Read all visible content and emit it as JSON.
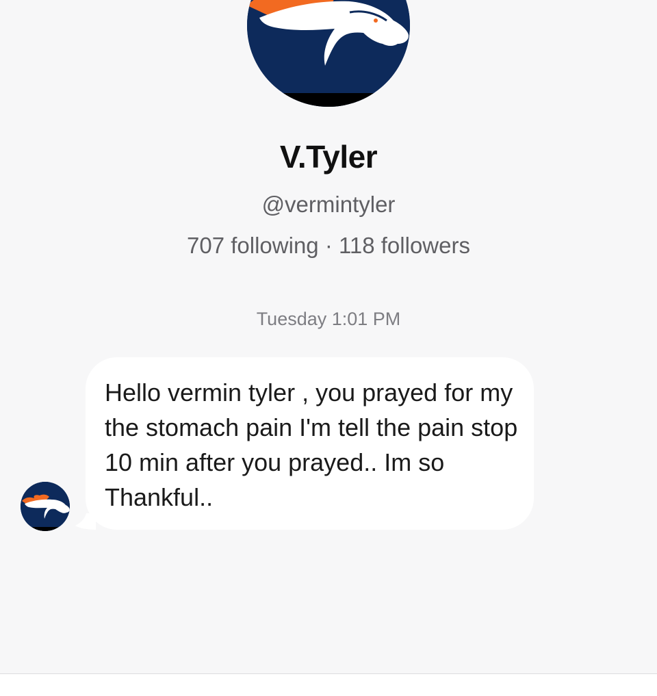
{
  "profile": {
    "avatar_icon": "broncos-horse-logo-icon",
    "display_name": "V.Tyler",
    "handle": "@vermintyler",
    "follow_stats": "707 following · 118 followers"
  },
  "conversation": {
    "timestamp": "Tuesday 1:01 PM",
    "messages": [
      {
        "sender_avatar_icon": "broncos-horse-logo-icon",
        "text": "Hello vermin tyler , you prayed for my the stomach pain I'm tell the pain stop 10 min after you prayed.. Im so Thankful.."
      }
    ]
  },
  "colors": {
    "background": "#f7f7f8",
    "bubble": "#ffffff",
    "logo_navy": "#0d2a5b",
    "logo_orange": "#f26a21"
  }
}
